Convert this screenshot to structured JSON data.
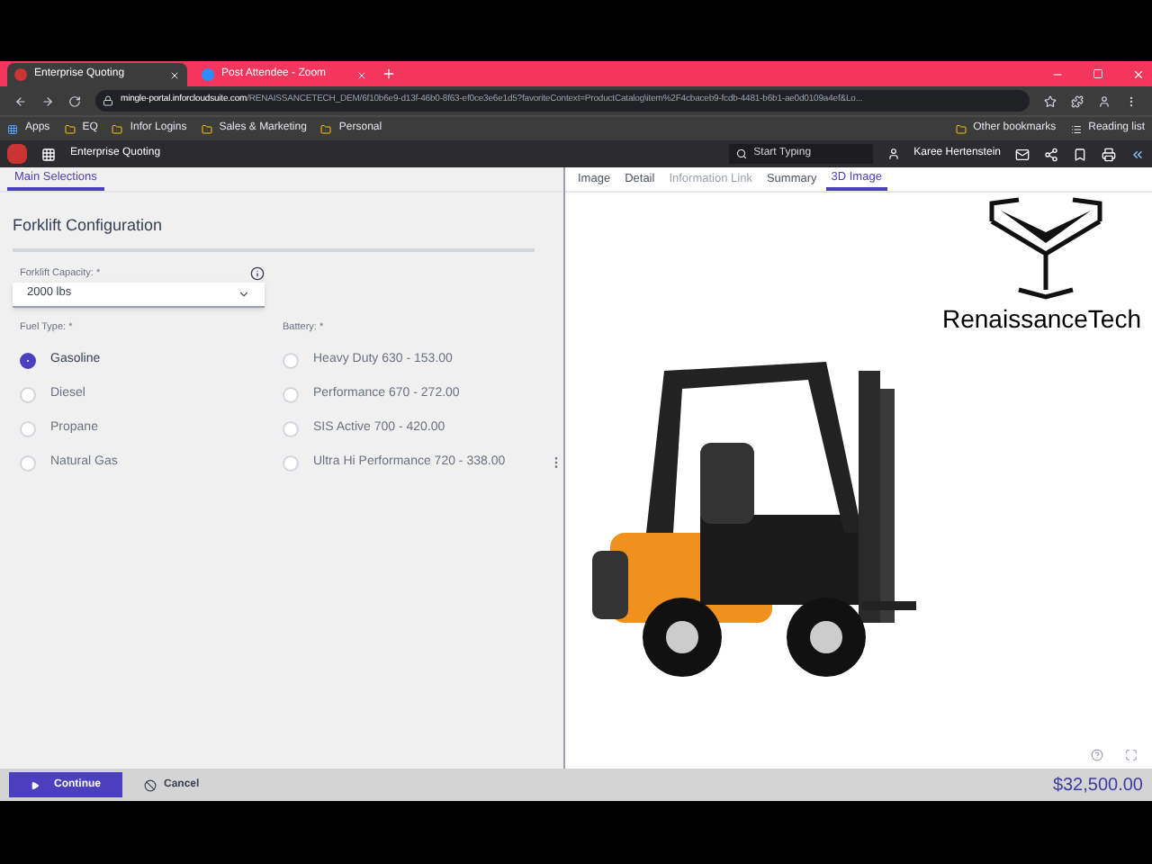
{
  "browser": {
    "tabs": [
      {
        "title": "Enterprise Quoting",
        "selected": true
      },
      {
        "title": "Post Attendee - Zoom",
        "selected": false
      }
    ],
    "address": {
      "host": "mingle-portal.inforcloudsuite.com",
      "path": "/RENAISSANCETECH_DEM/6f10b6e9-d13f-46b0-8f63-ef0ce3e6e1d5?favoriteContext=ProductCatalog\\item%2F4cbaceb9-fcdb-4481-b6b1-ae0d0109a4ef&Lo..."
    },
    "bookmarks": [
      "Apps",
      "EQ",
      "Infor Logins",
      "Sales & Marketing",
      "Personal"
    ],
    "bookmarks_right": [
      "Other bookmarks",
      "Reading list"
    ]
  },
  "app_header": {
    "title": "Enterprise Quoting",
    "search": {
      "placeholder": "Start Typing"
    },
    "user": "Karee Hertenstein"
  },
  "left_tabs": [
    {
      "label": "Main Selections",
      "selected": true
    }
  ],
  "section_title": "Forklift Configuration",
  "capacity": {
    "label": "Forklift Capacity: *",
    "value": "2000 lbs"
  },
  "fuel": {
    "label": "Fuel Type: *",
    "options": [
      {
        "label": "Gasoline",
        "selected": true
      },
      {
        "label": "Diesel",
        "selected": false
      },
      {
        "label": "Propane",
        "selected": false
      },
      {
        "label": "Natural Gas",
        "selected": false
      }
    ]
  },
  "battery": {
    "label": "Battery: *",
    "options": [
      {
        "label": "Heavy Duty 630 - 153.00",
        "selected": false
      },
      {
        "label": "Performance 670 - 272.00",
        "selected": false
      },
      {
        "label": "SIS Active 700 - 420.00",
        "selected": false
      },
      {
        "label": "Ultra Hi Performance 720 - 338.00",
        "selected": false
      }
    ]
  },
  "right_tabs": [
    {
      "label": "Image",
      "selected": false,
      "disabled": false
    },
    {
      "label": "Detail",
      "selected": false,
      "disabled": false
    },
    {
      "label": "Information Link",
      "selected": false,
      "disabled": true
    },
    {
      "label": "Summary",
      "selected": false,
      "disabled": false
    },
    {
      "label": "3D Image",
      "selected": true,
      "disabled": false
    }
  ],
  "logo_text": "RenaissanceTech",
  "footer": {
    "continue": "Continue",
    "cancel": "Cancel",
    "total": "$32,500.00"
  }
}
